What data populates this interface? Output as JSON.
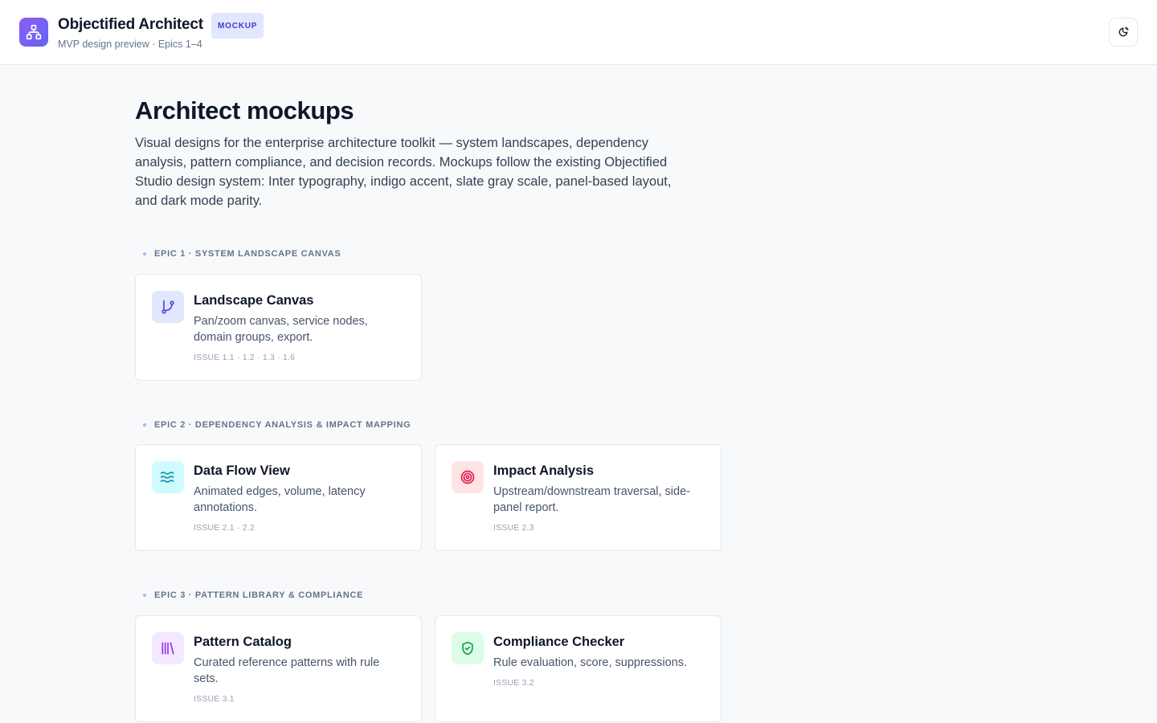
{
  "header": {
    "app_title": "Objectified Architect",
    "badge": "MOCKUP",
    "subtitle": "MVP design preview · Epics 1–4",
    "logo_icon": "network-icon",
    "theme_toggle_icon": "theme-toggle-icon"
  },
  "main": {
    "title": "Architect mockups",
    "intro": "Visual designs for the enterprise architecture toolkit — system landscapes, dependency analysis, pattern compliance, and decision records. Mockups follow the existing Objectified Studio design system: Inter typography, indigo accent, slate gray scale, panel-based layout, and dark mode parity."
  },
  "epics": [
    {
      "heading": "EPIC 1 · SYSTEM LANDSCAPE CANVAS",
      "cards": [
        {
          "title": "Landscape Canvas",
          "description": "Pan/zoom canvas, service nodes, domain groups, export.",
          "issue": "ISSUE 1.1 · 1.2 · 1.3 · 1.6",
          "icon": "git-branch-icon",
          "tile_color": "#e0e7ff",
          "icon_color": "#4f46e5"
        }
      ]
    },
    {
      "heading": "EPIC 2 · DEPENDENCY ANALYSIS & IMPACT MAPPING",
      "cards": [
        {
          "title": "Data Flow View",
          "description": "Animated edges, volume, latency annotations.",
          "issue": "ISSUE 2.1 · 2.2",
          "icon": "waves-icon",
          "tile_color": "#cffafe",
          "icon_color": "#0891b2"
        },
        {
          "title": "Impact Analysis",
          "description": "Upstream/downstream traversal, side-panel report.",
          "issue": "ISSUE 2.3",
          "icon": "target-icon",
          "tile_color": "#ffe4e6",
          "icon_color": "#e11d48"
        }
      ]
    },
    {
      "heading": "EPIC 3 · PATTERN LIBRARY & COMPLIANCE",
      "cards": [
        {
          "title": "Pattern Catalog",
          "description": "Curated reference patterns with rule sets.",
          "issue": "ISSUE 3.1",
          "icon": "library-icon",
          "tile_color": "#f3e8ff",
          "icon_color": "#9333ea"
        },
        {
          "title": "Compliance Checker",
          "description": "Rule evaluation, score, suppressions.",
          "issue": "ISSUE 3.2",
          "icon": "shield-check-icon",
          "tile_color": "#dcfce7",
          "icon_color": "#16a34a"
        }
      ]
    }
  ]
}
